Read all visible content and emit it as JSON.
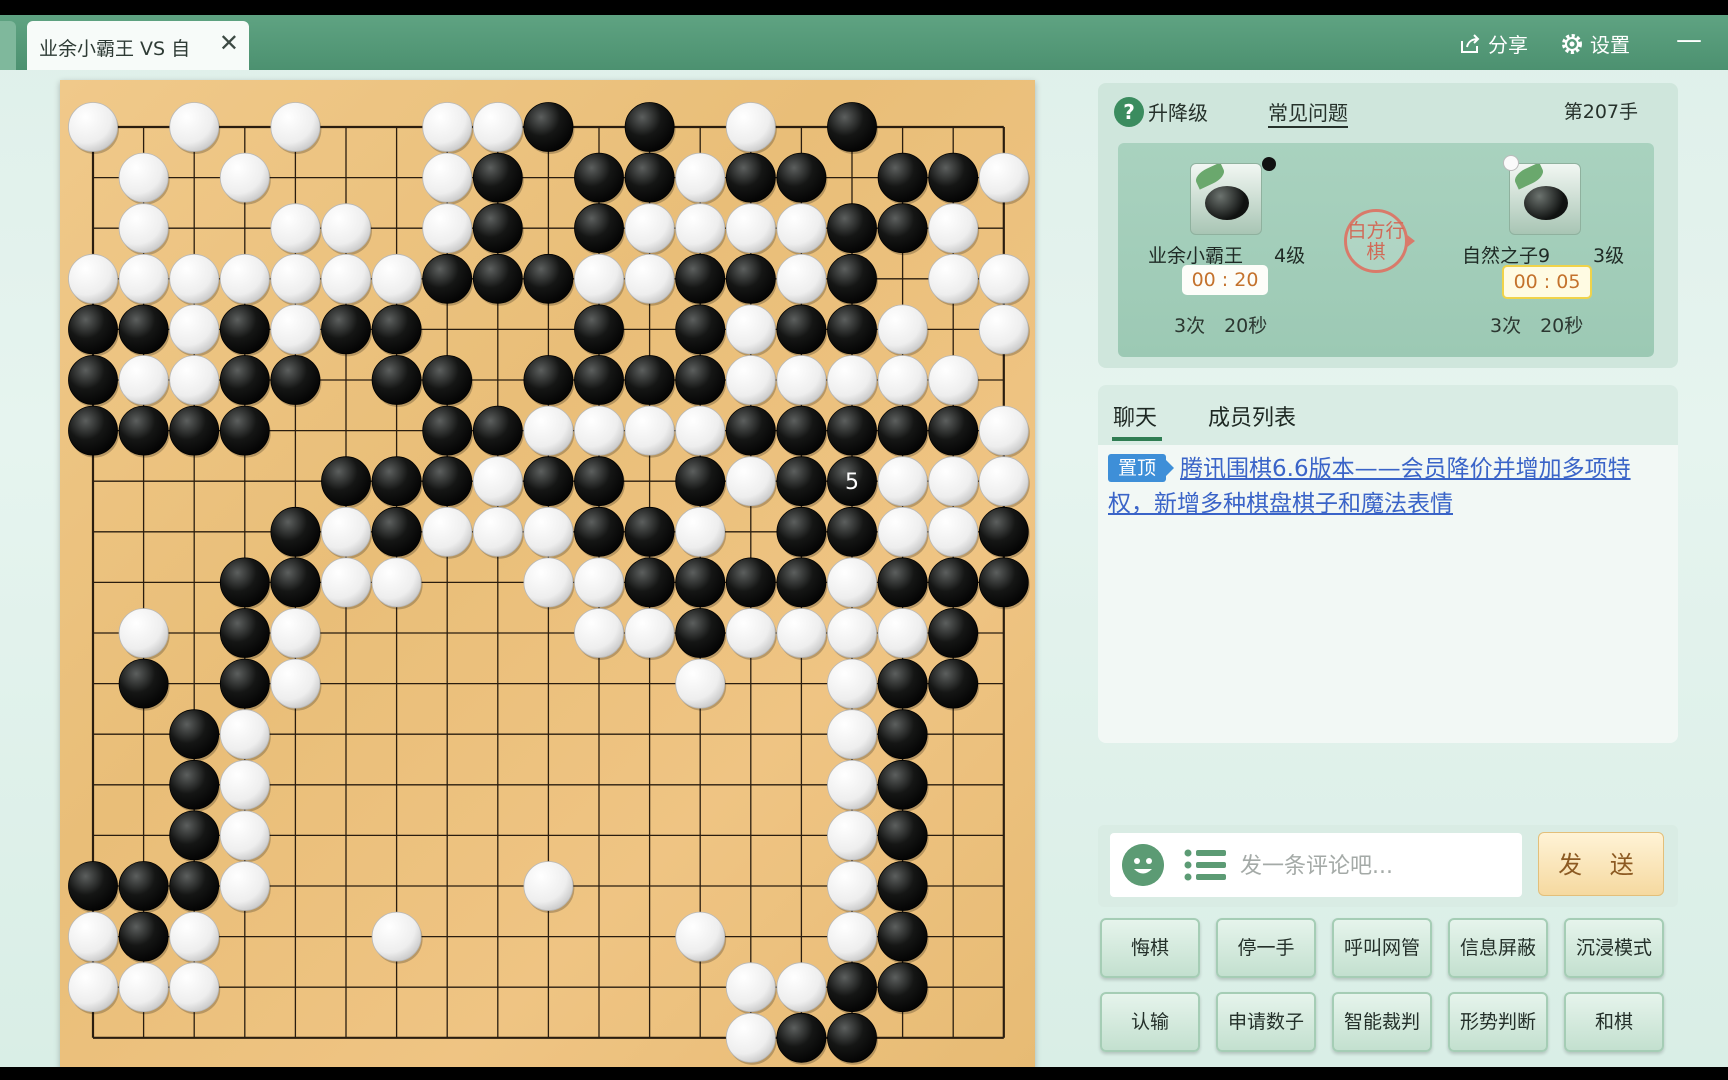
{
  "window": {
    "tab_title": "业余小霸王 VS 自",
    "close_glyph": "✕",
    "share_label": "分享",
    "settings_label": "设置",
    "minimize_glyph": "—"
  },
  "info": {
    "levelup_label": "升降级",
    "faq_label": "常见问题",
    "move_count": "第207手",
    "turn_label": "白方行棋",
    "black_player": {
      "name": "业余小霸王",
      "level": "4级",
      "timer": "00 : 20",
      "byoyomi": "3次　20秒"
    },
    "white_player": {
      "name": "自然之子9",
      "level": "3级",
      "timer": "00 : 05",
      "byoyomi": "3次　20秒"
    }
  },
  "chat": {
    "tab_chat": "聊天",
    "tab_members": "成员列表",
    "pin_label": "置顶",
    "announcement": "腾讯围棋6.6版本——会员降价并增加多项特权，新增多种棋盘棋子和魔法表情"
  },
  "input": {
    "placeholder": "发一条评论吧...",
    "send_label": "发 送"
  },
  "actions": {
    "row1": [
      "悔棋",
      "停一手",
      "呼叫网管",
      "信息屏蔽",
      "沉浸模式"
    ],
    "row2": [
      "认输",
      "申请数子",
      "智能裁判",
      "形势判断",
      "和棋"
    ]
  },
  "colors": {
    "accent_green": "#4c9170",
    "board_wood": "#efc483",
    "timer_text": "#c4722d",
    "link_blue": "#3a64c8"
  },
  "board": {
    "size": 19,
    "last_move_label": "5",
    "last_move": [
      15,
      7
    ],
    "black": [
      [
        9,
        0
      ],
      [
        11,
        0
      ],
      [
        15,
        0
      ],
      [
        8,
        1
      ],
      [
        10,
        1
      ],
      [
        11,
        1
      ],
      [
        13,
        1
      ],
      [
        14,
        1
      ],
      [
        16,
        1
      ],
      [
        17,
        1
      ],
      [
        8,
        2
      ],
      [
        10,
        2
      ],
      [
        15,
        2
      ],
      [
        16,
        2
      ],
      [
        7,
        3
      ],
      [
        8,
        3
      ],
      [
        9,
        3
      ],
      [
        12,
        3
      ],
      [
        13,
        3
      ],
      [
        15,
        3
      ],
      [
        0,
        4
      ],
      [
        1,
        4
      ],
      [
        3,
        4
      ],
      [
        5,
        4
      ],
      [
        6,
        4
      ],
      [
        10,
        4
      ],
      [
        12,
        4
      ],
      [
        14,
        4
      ],
      [
        15,
        4
      ],
      [
        0,
        5
      ],
      [
        3,
        5
      ],
      [
        4,
        5
      ],
      [
        6,
        5
      ],
      [
        7,
        5
      ],
      [
        9,
        5
      ],
      [
        10,
        5
      ],
      [
        11,
        5
      ],
      [
        12,
        5
      ],
      [
        0,
        6
      ],
      [
        1,
        6
      ],
      [
        2,
        6
      ],
      [
        3,
        6
      ],
      [
        7,
        6
      ],
      [
        8,
        6
      ],
      [
        13,
        6
      ],
      [
        14,
        6
      ],
      [
        15,
        6
      ],
      [
        16,
        6
      ],
      [
        17,
        6
      ],
      [
        5,
        7
      ],
      [
        6,
        7
      ],
      [
        7,
        7
      ],
      [
        9,
        7
      ],
      [
        10,
        7
      ],
      [
        12,
        7
      ],
      [
        14,
        7
      ],
      [
        15,
        7
      ],
      [
        4,
        8
      ],
      [
        6,
        8
      ],
      [
        10,
        8
      ],
      [
        11,
        8
      ],
      [
        14,
        8
      ],
      [
        15,
        8
      ],
      [
        18,
        8
      ],
      [
        3,
        9
      ],
      [
        4,
        9
      ],
      [
        11,
        9
      ],
      [
        12,
        9
      ],
      [
        13,
        9
      ],
      [
        14,
        9
      ],
      [
        16,
        9
      ],
      [
        17,
        9
      ],
      [
        18,
        9
      ],
      [
        3,
        10
      ],
      [
        12,
        10
      ],
      [
        17,
        10
      ],
      [
        1,
        11
      ],
      [
        3,
        11
      ],
      [
        16,
        11
      ],
      [
        17,
        11
      ],
      [
        2,
        12
      ],
      [
        16,
        12
      ],
      [
        2,
        13
      ],
      [
        16,
        13
      ],
      [
        2,
        14
      ],
      [
        16,
        14
      ],
      [
        0,
        15
      ],
      [
        1,
        15
      ],
      [
        2,
        15
      ],
      [
        16,
        15
      ],
      [
        1,
        16
      ],
      [
        16,
        16
      ],
      [
        15,
        17
      ],
      [
        16,
        17
      ],
      [
        14,
        18
      ],
      [
        15,
        18
      ]
    ],
    "white": [
      [
        0,
        0
      ],
      [
        2,
        0
      ],
      [
        4,
        0
      ],
      [
        7,
        0
      ],
      [
        8,
        0
      ],
      [
        13,
        0
      ],
      [
        1,
        1
      ],
      [
        3,
        1
      ],
      [
        7,
        1
      ],
      [
        12,
        1
      ],
      [
        18,
        1
      ],
      [
        1,
        2
      ],
      [
        4,
        2
      ],
      [
        5,
        2
      ],
      [
        7,
        2
      ],
      [
        11,
        2
      ],
      [
        12,
        2
      ],
      [
        13,
        2
      ],
      [
        14,
        2
      ],
      [
        17,
        2
      ],
      [
        0,
        3
      ],
      [
        1,
        3
      ],
      [
        2,
        3
      ],
      [
        3,
        3
      ],
      [
        4,
        3
      ],
      [
        5,
        3
      ],
      [
        6,
        3
      ],
      [
        10,
        3
      ],
      [
        11,
        3
      ],
      [
        14,
        3
      ],
      [
        17,
        3
      ],
      [
        18,
        3
      ],
      [
        2,
        4
      ],
      [
        4,
        4
      ],
      [
        13,
        4
      ],
      [
        16,
        4
      ],
      [
        18,
        4
      ],
      [
        1,
        5
      ],
      [
        2,
        5
      ],
      [
        13,
        5
      ],
      [
        14,
        5
      ],
      [
        15,
        5
      ],
      [
        16,
        5
      ],
      [
        17,
        5
      ],
      [
        9,
        6
      ],
      [
        10,
        6
      ],
      [
        11,
        6
      ],
      [
        12,
        6
      ],
      [
        18,
        6
      ],
      [
        8,
        7
      ],
      [
        13,
        7
      ],
      [
        16,
        7
      ],
      [
        17,
        7
      ],
      [
        18,
        7
      ],
      [
        5,
        8
      ],
      [
        7,
        8
      ],
      [
        8,
        8
      ],
      [
        9,
        8
      ],
      [
        12,
        8
      ],
      [
        16,
        8
      ],
      [
        17,
        8
      ],
      [
        5,
        9
      ],
      [
        6,
        9
      ],
      [
        9,
        9
      ],
      [
        10,
        9
      ],
      [
        15,
        9
      ],
      [
        1,
        10
      ],
      [
        4,
        10
      ],
      [
        10,
        10
      ],
      [
        11,
        10
      ],
      [
        13,
        10
      ],
      [
        14,
        10
      ],
      [
        15,
        10
      ],
      [
        16,
        10
      ],
      [
        4,
        11
      ],
      [
        12,
        11
      ],
      [
        15,
        11
      ],
      [
        3,
        12
      ],
      [
        15,
        12
      ],
      [
        3,
        13
      ],
      [
        15,
        13
      ],
      [
        3,
        14
      ],
      [
        15,
        14
      ],
      [
        3,
        15
      ],
      [
        9,
        15
      ],
      [
        15,
        15
      ],
      [
        0,
        16
      ],
      [
        2,
        16
      ],
      [
        6,
        16
      ],
      [
        12,
        16
      ],
      [
        15,
        16
      ],
      [
        0,
        17
      ],
      [
        1,
        17
      ],
      [
        2,
        17
      ],
      [
        13,
        17
      ],
      [
        14,
        17
      ],
      [
        13,
        18
      ]
    ]
  }
}
